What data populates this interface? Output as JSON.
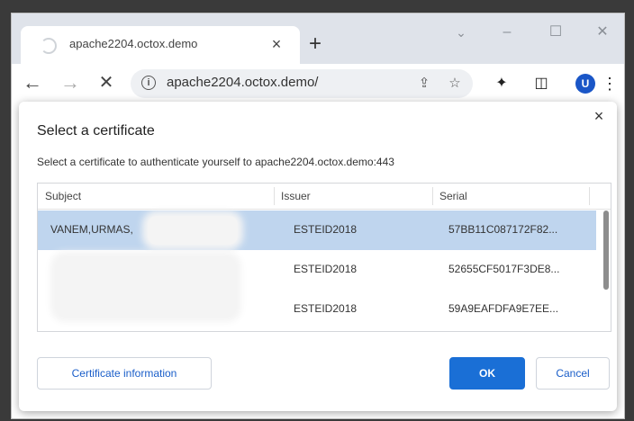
{
  "tab": {
    "title": "apache2204.octox.demo",
    "close": "×",
    "new_tab": "+"
  },
  "window": {
    "search_tabs": "⌄",
    "minimize": "–",
    "maximize": "☐",
    "close": "✕"
  },
  "toolbar": {
    "back": "←",
    "forward": "→",
    "stop": "✕",
    "url": "apache2204.octox.demo/",
    "info": "i",
    "share": "⇪",
    "bookmark": "☆",
    "extensions": "✦",
    "sidepanel": "◫",
    "profile_initial": "U",
    "menu": "⋮"
  },
  "dialog": {
    "title": "Select a certificate",
    "description": "Select a certificate to authenticate yourself to apache2204.octox.demo:443",
    "close": "×",
    "columns": [
      "Subject",
      "Issuer",
      "Serial"
    ],
    "rows": [
      {
        "subject": "VANEM,URMAS,",
        "issuer": "ESTEID2018",
        "serial": "57BB11C087172F82...",
        "selected": true
      },
      {
        "subject": "",
        "issuer": "ESTEID2018",
        "serial": "52655CF5017F3DE8...",
        "selected": false
      },
      {
        "subject": "",
        "issuer": "ESTEID2018",
        "serial": "59A9EAFDFA9E7EE...",
        "selected": false
      }
    ],
    "buttons": {
      "certificate_info": "Certificate information",
      "ok": "OK",
      "cancel": "Cancel"
    }
  },
  "colors": {
    "accent": "#1a6fd6",
    "selection": "#bfd5ee",
    "avatar": "#1a56c7"
  }
}
